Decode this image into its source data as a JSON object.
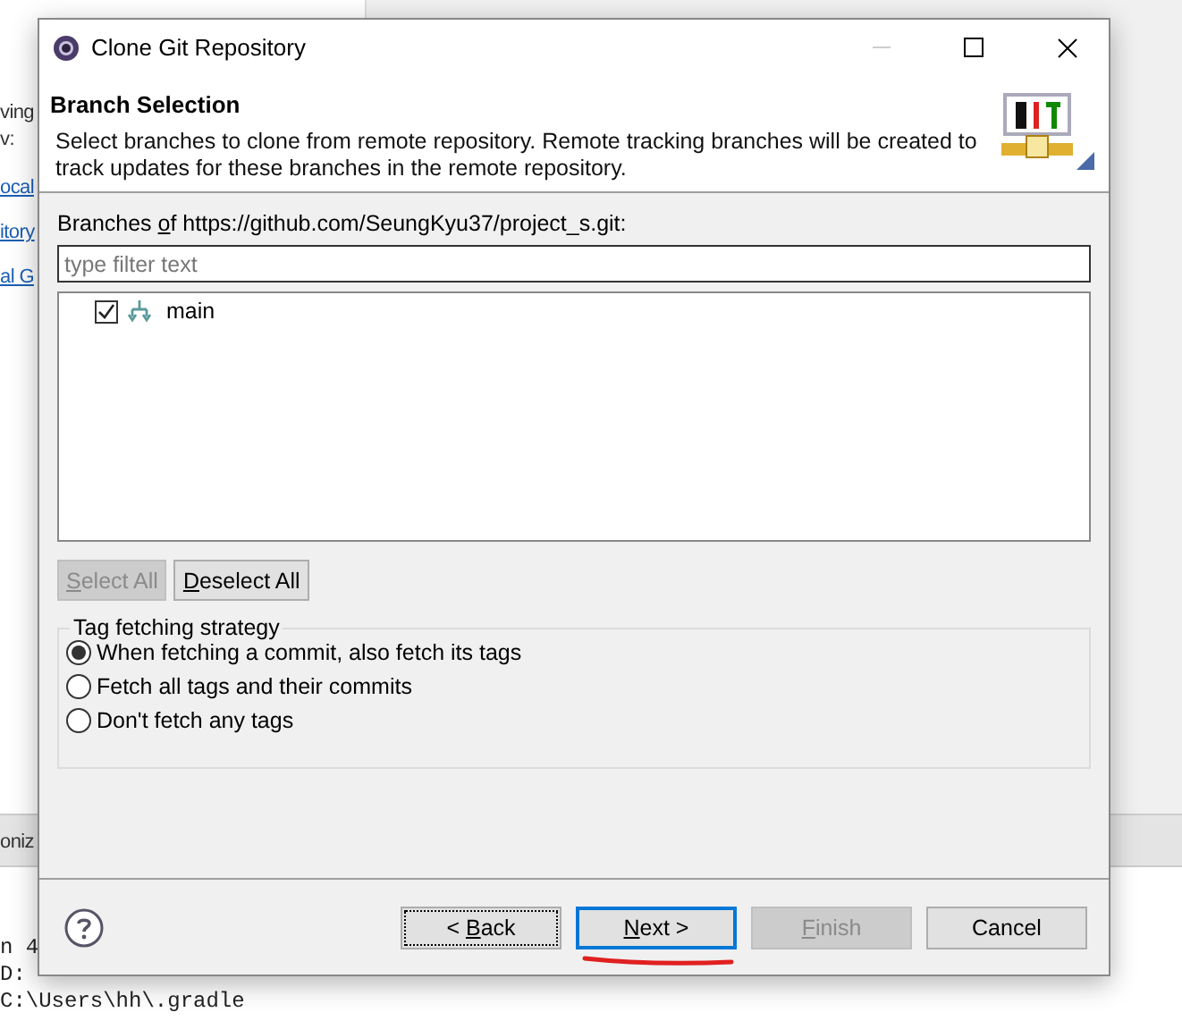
{
  "background": {
    "left_fragments": [
      "ving",
      "v:"
    ],
    "links": [
      "ocal",
      "itory",
      "al G"
    ],
    "tab_fragment": "oniz",
    "console_lines": [
      "n 4",
      "D:",
      "C:\\Users\\hh\\.gradle"
    ]
  },
  "window": {
    "title": "Clone Git Repository"
  },
  "header": {
    "title": "Branch Selection",
    "description": "Select branches to clone from remote repository. Remote tracking branches will be created to track updates for these branches in the remote repository."
  },
  "branches_label": {
    "pre": "Branches ",
    "key": "o",
    "post": "f https://github.com/SeungKyu37/project_s.git:"
  },
  "filter": {
    "placeholder": "type filter text"
  },
  "branches": [
    {
      "name": "main",
      "checked": true
    }
  ],
  "select_buttons": [
    {
      "label": {
        "key": "S",
        "post": "elect All"
      },
      "disabled": true
    },
    {
      "label": {
        "key": "D",
        "post": "eselect All"
      },
      "disabled": false
    }
  ],
  "tag_group": {
    "title": "Tag fetching strategy",
    "options": [
      {
        "label": "When fetching a commit, also fetch its tags",
        "selected": true
      },
      {
        "label": "Fetch all tags and their commits",
        "selected": false
      },
      {
        "label": "Don't fetch any tags",
        "selected": false
      }
    ]
  },
  "footer_buttons": [
    {
      "label": {
        "pre": "< ",
        "key": "B",
        "post": "ack"
      },
      "disabled": false,
      "focused": false
    },
    {
      "label": {
        "key": "N",
        "post": "ext >"
      },
      "disabled": false,
      "focused": true
    },
    {
      "label": {
        "key": "F",
        "post": "inish"
      },
      "disabled": true,
      "focused": false
    },
    {
      "label": {
        "pre": "Cancel"
      },
      "disabled": false,
      "focused": false
    }
  ],
  "annotation": {
    "kind": "underline"
  }
}
